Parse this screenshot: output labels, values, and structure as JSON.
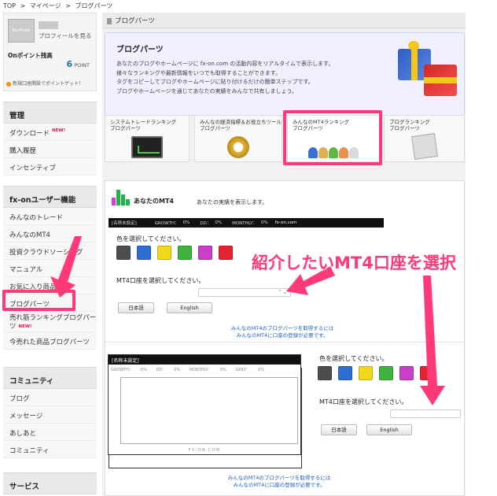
{
  "breadcrumb": {
    "top": "TOP",
    "sep": ">",
    "mypage": "マイページ",
    "current": "ブログパーツ"
  },
  "profile": {
    "avatar_text": "No.Photo",
    "link": "プロフィールを見る",
    "points_label": "Onポイント残高",
    "points_value": "6",
    "points_unit": "POINT",
    "promo": "新規口座開設でポイントゲット！"
  },
  "sidebar": {
    "sections": [
      {
        "title": "管理",
        "items": [
          {
            "label": "ダウンロード",
            "new": "NEW!"
          },
          {
            "label": "購入履歴"
          },
          {
            "label": "インセンティブ"
          }
        ]
      },
      {
        "title": "fx-onユーザー機能",
        "items": [
          {
            "label": "みんなのトレード"
          },
          {
            "label": "みんなのMT4"
          },
          {
            "label": "投資クラウドソーシング"
          },
          {
            "label": "マニュアル"
          },
          {
            "label": "お気に入り商品"
          },
          {
            "label": "ブログパーツ"
          },
          {
            "label": "売れ筋ランキングブログパーツ",
            "new": "NEW!"
          },
          {
            "label": "今売れた商品ブログパーツ"
          }
        ]
      },
      {
        "title": "コミュニティ",
        "items": [
          {
            "label": "ブログ"
          },
          {
            "label": "メッセージ"
          },
          {
            "label": "あしあと"
          },
          {
            "label": "コミュニティ"
          }
        ]
      },
      {
        "title": "サービス",
        "items": []
      }
    ]
  },
  "main": {
    "header": "ブログパーツ",
    "banner": {
      "title": "ブログパーツ",
      "lines": [
        "あなたのブログやホームページに fx-on.com の活動内容をリアルタイムで表示します。",
        "様々なランキングや最新情報をいつでも取得することができます。",
        "タグをコピーしてブログやホームページに貼り付けるだけの簡単ステップです。",
        "ブログやホームページを通じてあなたの実績をみんなで共有しましょう。"
      ]
    },
    "tabs": [
      {
        "line1": "システムトレードランキング",
        "line2": "ブログパーツ",
        "icon": "monitor-icon"
      },
      {
        "line1": "みんなの経済指標＆お役立ちツール",
        "line2": "ブログパーツ",
        "icon": "compass-icon"
      },
      {
        "line1": "みんなのMT4ランキング",
        "line2": "ブログパーツ",
        "icon": "people-icon"
      },
      {
        "line1": "ブログランキング",
        "line2": "ブログパーツ",
        "icon": "pen-icon"
      }
    ],
    "panel": {
      "title": "あなたのMT4",
      "subtitle": "あなたの実績を表示します。",
      "strip": {
        "name": "[名称未設定]",
        "growth": "GROWTH：",
        "growth_v": "0%",
        "dd": "DD：",
        "dd_v": "0%",
        "monthly": "MONTHLY：",
        "monthly_v": "0%",
        "site": "fx-on.com"
      },
      "color_label": "色を選択してください。",
      "account_label": "MT4口座を選択してください。",
      "btn_ja": "日本語",
      "btn_en": "English",
      "note1": "みんなのMT4のブログパーツを取得するには",
      "note2": "みんなのMT4に口座の登録が必要です。",
      "chart": {
        "name": "[名称未設定]",
        "growth": "GROWTH：",
        "growth_v": "0%",
        "dd": "DD：",
        "dd_v": "0%",
        "monthly": "MONTHLY：",
        "monthly_v": "0%",
        "daily": "DAILY：",
        "daily_v": "0%",
        "foot": "FX-ON.COM"
      }
    }
  },
  "swatches": [
    "#4d4d4d",
    "#2f6fd4",
    "#f0d81c",
    "#3fb23f",
    "#c93fc9",
    "#e3232f"
  ],
  "annotation": "紹介したいMT4口座を選択",
  "colors": {
    "accent": "#ff3a77",
    "link": "#1e5fc4",
    "points": "#2a6fb0"
  }
}
